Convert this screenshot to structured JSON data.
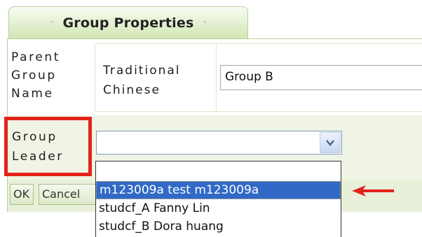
{
  "tab": {
    "title": "Group Properties",
    "left_dot": "•",
    "right_dot": "•"
  },
  "parent_group_name": {
    "label_lines": [
      "Parent",
      "Group",
      "Name"
    ],
    "language_label_lines": [
      "Traditional",
      "Chinese"
    ],
    "value": "Group B"
  },
  "group_leader": {
    "label_lines": [
      "Group",
      "Leader"
    ],
    "selected_value": "",
    "options": [
      "",
      "m123009a test m123009a",
      "studcf_A Fanny Lin",
      "studcf_B Dora huang"
    ],
    "highlighted_option": "m123009a test m123009a"
  },
  "buttons": {
    "ok": "OK",
    "cancel": "Cancel"
  },
  "colors": {
    "annotation": "#e2231a",
    "selection": "#3169c6",
    "tab_gradient_bottom": "#d2e6b4"
  },
  "icons": {
    "select_arrow": "chevron-down-icon",
    "annotation_arrow": "arrow-left-icon"
  }
}
